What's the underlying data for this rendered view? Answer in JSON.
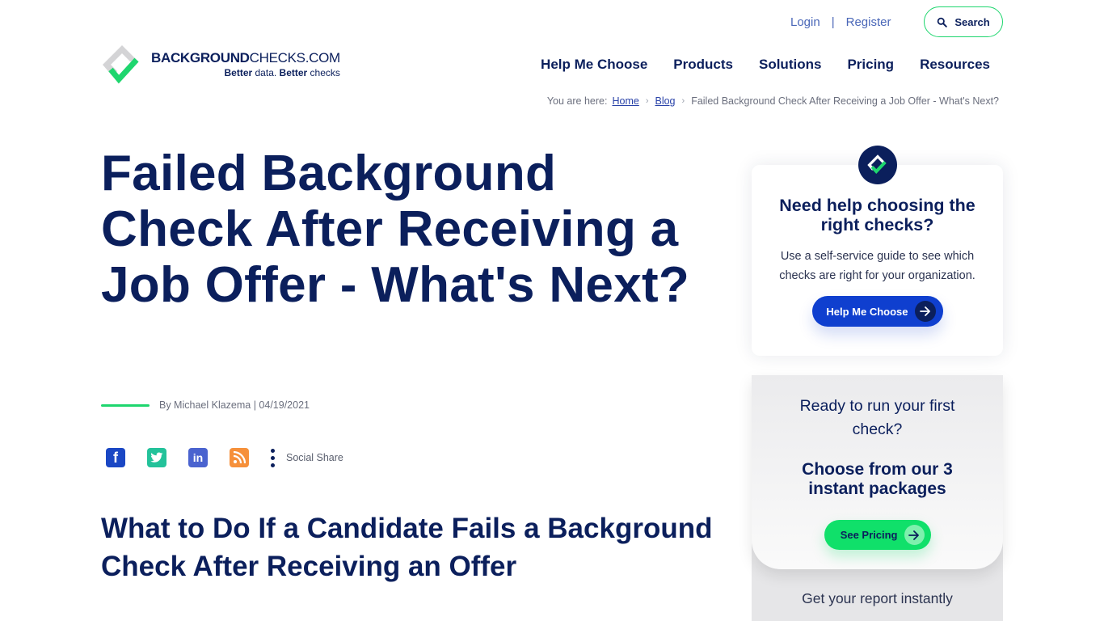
{
  "header": {
    "login": "Login",
    "separator": "|",
    "register": "Register",
    "search_label": "Search",
    "logo": {
      "name_bold": "BACKGROUND",
      "name_regular": "CHECKS.COM",
      "tag_bold_1": "Better",
      "tag_regular_1": " data. ",
      "tag_bold_2": "Better",
      "tag_regular_2": " checks"
    },
    "nav": [
      "Help Me Choose",
      "Products",
      "Solutions",
      "Pricing",
      "Resources"
    ]
  },
  "breadcrumb": {
    "prefix": "You are here:",
    "items": [
      "Home",
      "Blog"
    ],
    "current": "Failed Background Check After Receiving a Job Offer - What's Next?",
    "separator": "›"
  },
  "article": {
    "title": "Failed Background Check After Receiving a Job Offer - What's Next?",
    "byline": "By Michael Klazema | 04/19/2021",
    "social": {
      "icons": [
        "facebook-icon",
        "twitter-icon",
        "linkedin-icon",
        "rss-icon"
      ],
      "share_label": "Social Share"
    },
    "subheading": "What to Do If a Candidate Fails a Background Check After Receiving an Offer"
  },
  "sidebar": {
    "help_card": {
      "heading": "Need help choosing the right checks?",
      "text": "Use a self-service guide to see which checks are right for your organization.",
      "button": "Help Me Choose"
    },
    "pricing_card": {
      "question": "Ready to run your first check?",
      "heading": "Choose from our 3 instant packages",
      "button": "See Pricing",
      "footer": "Get your report instantly"
    }
  },
  "colors": {
    "navy": "#0b1f5c",
    "green": "#1ed66e",
    "blue_button": "#0f3fcf",
    "green_button": "#10e06a"
  }
}
